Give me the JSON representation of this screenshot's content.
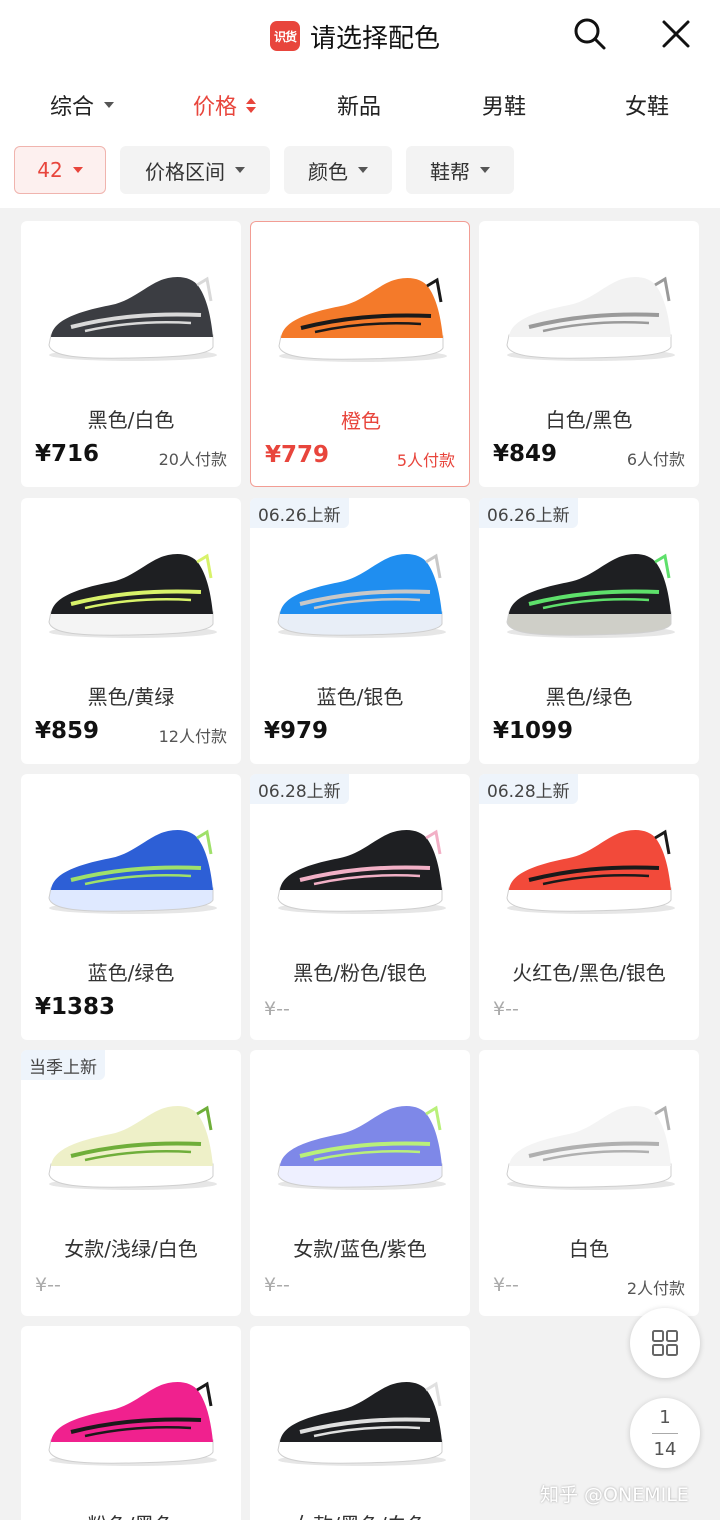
{
  "header": {
    "logo_text": "识货",
    "title": "请选择配色",
    "icons": [
      "search-icon",
      "close-icon"
    ]
  },
  "tabs": [
    {
      "label": "综合",
      "indicator": "dropdown"
    },
    {
      "label": "价格",
      "indicator": "sort",
      "active": true
    },
    {
      "label": "新品"
    },
    {
      "label": "男鞋"
    },
    {
      "label": "女鞋"
    }
  ],
  "filters": [
    {
      "label": "42",
      "active": true
    },
    {
      "label": "价格区间"
    },
    {
      "label": "颜色"
    },
    {
      "label": "鞋帮"
    }
  ],
  "products": [
    {
      "color_name": "黑色/白色",
      "price": "¥716",
      "paid": "20人付款",
      "badge": "",
      "upper": "#3b3d42",
      "accent": "#d9d9d9",
      "sole": "#ffffff"
    },
    {
      "color_name": "橙色",
      "price": "¥779",
      "paid": "5人付款",
      "badge": "",
      "upper": "#f47a2a",
      "accent": "#1a1a1a",
      "sole": "#ffffff",
      "selected": true
    },
    {
      "color_name": "白色/黑色",
      "price": "¥849",
      "paid": "6人付款",
      "badge": "",
      "upper": "#f2f2f2",
      "accent": "#9a9a9a",
      "sole": "#ffffff"
    },
    {
      "color_name": "黑色/黄绿",
      "price": "¥859",
      "paid": "12人付款",
      "badge": "",
      "upper": "#1e1f22",
      "accent": "#d8f26a",
      "sole": "#f4f4f4"
    },
    {
      "color_name": "蓝色/银色",
      "price": "¥979",
      "paid": "",
      "badge": "06.26上新",
      "upper": "#1f8ef0",
      "accent": "#c8c8c8",
      "sole": "#e8eef7"
    },
    {
      "color_name": "黑色/绿色",
      "price": "¥1099",
      "paid": "",
      "badge": "06.26上新",
      "upper": "#1e1f22",
      "accent": "#5ee06b",
      "sole": "#cfcfc8"
    },
    {
      "color_name": "蓝色/绿色",
      "price": "¥1383",
      "paid": "",
      "badge": "",
      "upper": "#2d5fd6",
      "accent": "#9fe06a",
      "sole": "#dfe9ff"
    },
    {
      "color_name": "黑色/粉色/银色",
      "price": "¥--",
      "paid": "",
      "badge": "06.28上新",
      "upper": "#1e1f22",
      "accent": "#f2b0c6",
      "sole": "#ffffff"
    },
    {
      "color_name": "火红色/黑色/银色",
      "price": "¥--",
      "paid": "",
      "badge": "06.28上新",
      "upper": "#f24a3a",
      "accent": "#1a1a1a",
      "sole": "#ffffff"
    },
    {
      "color_name": "女款/浅绿/白色",
      "price": "¥--",
      "paid": "",
      "badge": "当季上新",
      "upper": "#eef0c8",
      "accent": "#6fae3a",
      "sole": "#ffffff"
    },
    {
      "color_name": "女款/蓝色/紫色",
      "price": "¥--",
      "paid": "",
      "badge": "",
      "upper": "#7e88e8",
      "accent": "#b9f07a",
      "sole": "#eef0ff"
    },
    {
      "color_name": "白色",
      "price": "¥--",
      "paid": "2人付款",
      "badge": "",
      "upper": "#f4f4f4",
      "accent": "#b0b0b0",
      "sole": "#ffffff"
    },
    {
      "color_name": "粉色/黑色",
      "price": "",
      "paid": "",
      "badge": "",
      "upper": "#f0218e",
      "accent": "#1a1a1a",
      "sole": "#ffffff"
    },
    {
      "color_name": "女款/黑色/白色",
      "price": "",
      "paid": "",
      "badge": "",
      "upper": "#1e1f22",
      "accent": "#e0e0e0",
      "sole": "#ffffff"
    }
  ],
  "pager": {
    "current": "1",
    "total": "14"
  },
  "watermark": "知乎 @ONEMILE",
  "colors": {
    "accent": "#e8453c",
    "background": "#f2f2f2"
  }
}
